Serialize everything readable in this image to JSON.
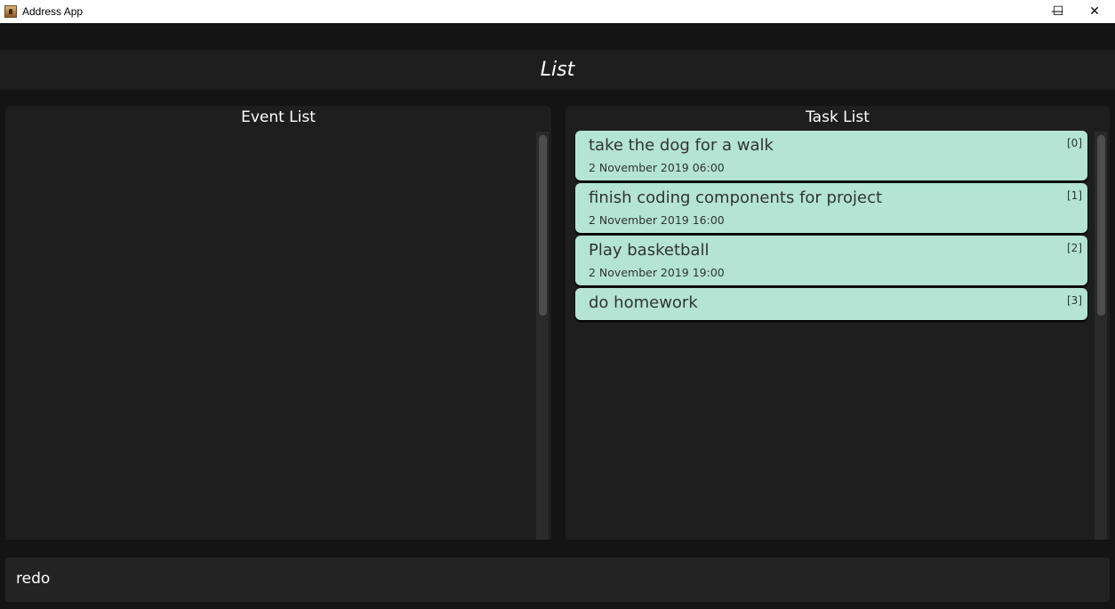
{
  "window": {
    "title": "Address App",
    "minimize": "—",
    "maximize": "☐",
    "close": "✕"
  },
  "header": {
    "title": "List"
  },
  "event_list": {
    "title": "Event List",
    "items": []
  },
  "task_list": {
    "title": "Task List",
    "items": [
      {
        "name": "take the dog for a walk",
        "date": "2 November 2019 06:00",
        "index": "[0]"
      },
      {
        "name": "finish coding components for project",
        "date": "2 November 2019 16:00",
        "index": "[1]"
      },
      {
        "name": "Play basketball",
        "date": "2 November 2019 19:00",
        "index": "[2]"
      },
      {
        "name": "do homework",
        "date": "",
        "index": "[3]"
      }
    ]
  },
  "command": {
    "value": "redo"
  }
}
